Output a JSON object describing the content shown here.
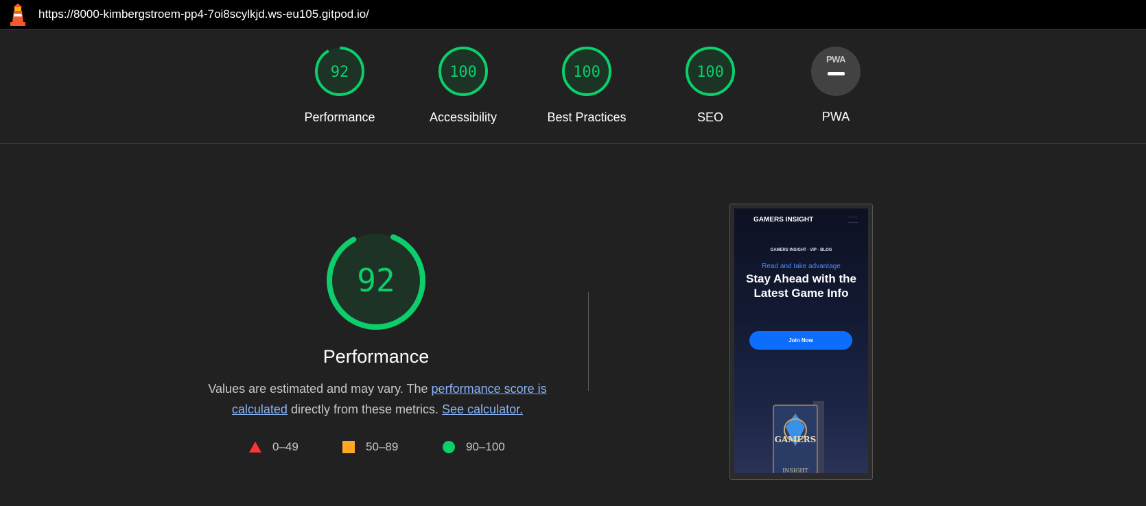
{
  "browser": {
    "url": "https://8000-kimbergstroem-pp4-7oi8scylkjd.ws-eu105.gitpod.io/",
    "icon": "lighthouse-icon"
  },
  "summary": {
    "gauges": [
      {
        "label": "Performance",
        "score": "92",
        "value": 0.92
      },
      {
        "label": "Accessibility",
        "score": "100",
        "value": 1.0
      },
      {
        "label": "Best Practices",
        "score": "100",
        "value": 1.0
      },
      {
        "label": "SEO",
        "score": "100",
        "value": 1.0
      }
    ],
    "pwa": {
      "label": "PWA",
      "badge_text": "PWA"
    }
  },
  "performance": {
    "score": "92",
    "value": 0.92,
    "title": "Performance",
    "desc_prefix": "Values are estimated and may vary. The ",
    "desc_link1": "performance score is calculated",
    "desc_middle": " directly from these metrics. ",
    "desc_link2": "See calculator."
  },
  "legend": [
    {
      "range": "0–49",
      "shape": "triangle",
      "color": "#ff3333"
    },
    {
      "range": "50–89",
      "shape": "square",
      "color": "#ffa726"
    },
    {
      "range": "90–100",
      "shape": "circle",
      "color": "#0cce6b"
    }
  ],
  "screenshot": {
    "brand": "GAMERS INSIGHT",
    "subtitle": "GAMERS INSIGHT · VIP · BLOG",
    "eyebrow": "Read and take advantage",
    "headline": "Stay Ahead with the Latest Game Info",
    "button": "Join Now",
    "book_title": "GAMERS",
    "book_bottom": "INSIGHT"
  },
  "colors": {
    "pass": "#0cce6b",
    "pass_bg": "#1c3326",
    "link": "#8ab4f8",
    "background": "#212121"
  }
}
